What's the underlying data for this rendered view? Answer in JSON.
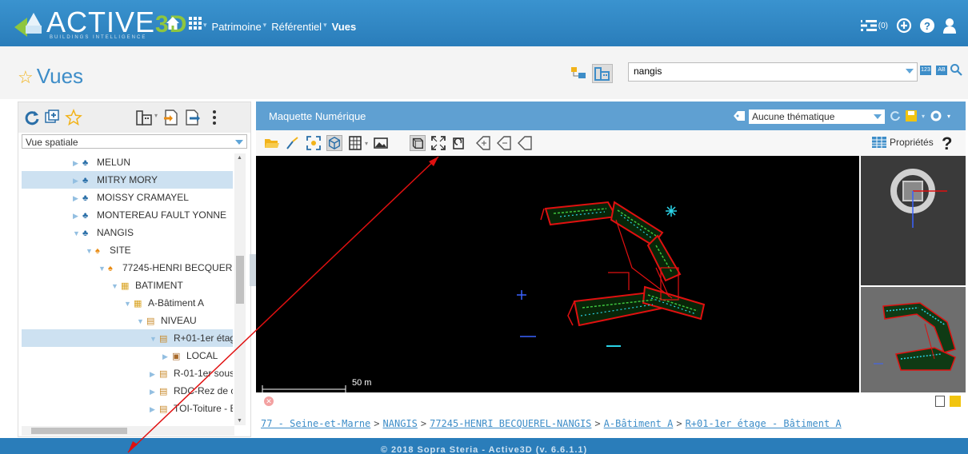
{
  "app": {
    "logo_text": "ACTIVE",
    "logo_accent": "3D",
    "logo_tagline": "BUILDINGS INTELLIGENCE",
    "nav": [
      "Patrimoine",
      "Référentiel",
      "Vues"
    ],
    "cart_count": "(0)"
  },
  "page": {
    "title": "Vues",
    "search_value": "nangis",
    "mini_btn_1": "123",
    "mini_btn_2": "AB"
  },
  "left": {
    "dropdown_value": "Vue spatiale",
    "tree": [
      {
        "label": "MELUN",
        "icon": "commune-icon"
      },
      {
        "label": "MITRY MORY",
        "icon": "commune-icon"
      },
      {
        "label": "MOISSY CRAMAYEL",
        "icon": "commune-icon"
      },
      {
        "label": "MONTEREAU FAULT YONNE",
        "icon": "commune-icon"
      },
      {
        "label": "NANGIS",
        "icon": "commune-icon"
      },
      {
        "label": "SITE",
        "icon": "site-icon"
      },
      {
        "label": "77245-HENRI BECQUER",
        "icon": "site-icon"
      },
      {
        "label": "BATIMENT",
        "icon": "building-icon"
      },
      {
        "label": "A-Bâtiment A",
        "icon": "building-icon"
      },
      {
        "label": "NIVEAU",
        "icon": "level-icon"
      },
      {
        "label": "R+01-1er étag",
        "icon": "level-icon"
      },
      {
        "label": "LOCAL",
        "icon": "room-icon"
      },
      {
        "label": "R-01-1er sous",
        "icon": "level-icon"
      },
      {
        "label": "RDC-Rez de c",
        "icon": "level-icon"
      },
      {
        "label": "TOI-Toiture - E",
        "icon": "level-icon"
      }
    ]
  },
  "main": {
    "title": "Maquette Numérique",
    "thematic": "Aucune thématique",
    "properties_label": "Propriétés",
    "scale_label": "50 m",
    "breadcrumb": [
      "77 - Seine-et-Marne",
      "NANGIS",
      "77245-HENRI BECQUEREL-NANGIS",
      "A-Bâtiment A",
      "R+01-1er étage - Bâtiment A"
    ]
  },
  "footer": {
    "text": "© 2018 Sopra Steria - Active3D (v. 6.6.1.1)"
  },
  "colors": {
    "header_blue": "#2a7dba",
    "panel_blue": "#5fa0d2",
    "accent_green": "#8ec63f",
    "plan_red": "#e01010",
    "plan_green": "#3ec43e",
    "plan_cyan": "#2ad4e8"
  }
}
